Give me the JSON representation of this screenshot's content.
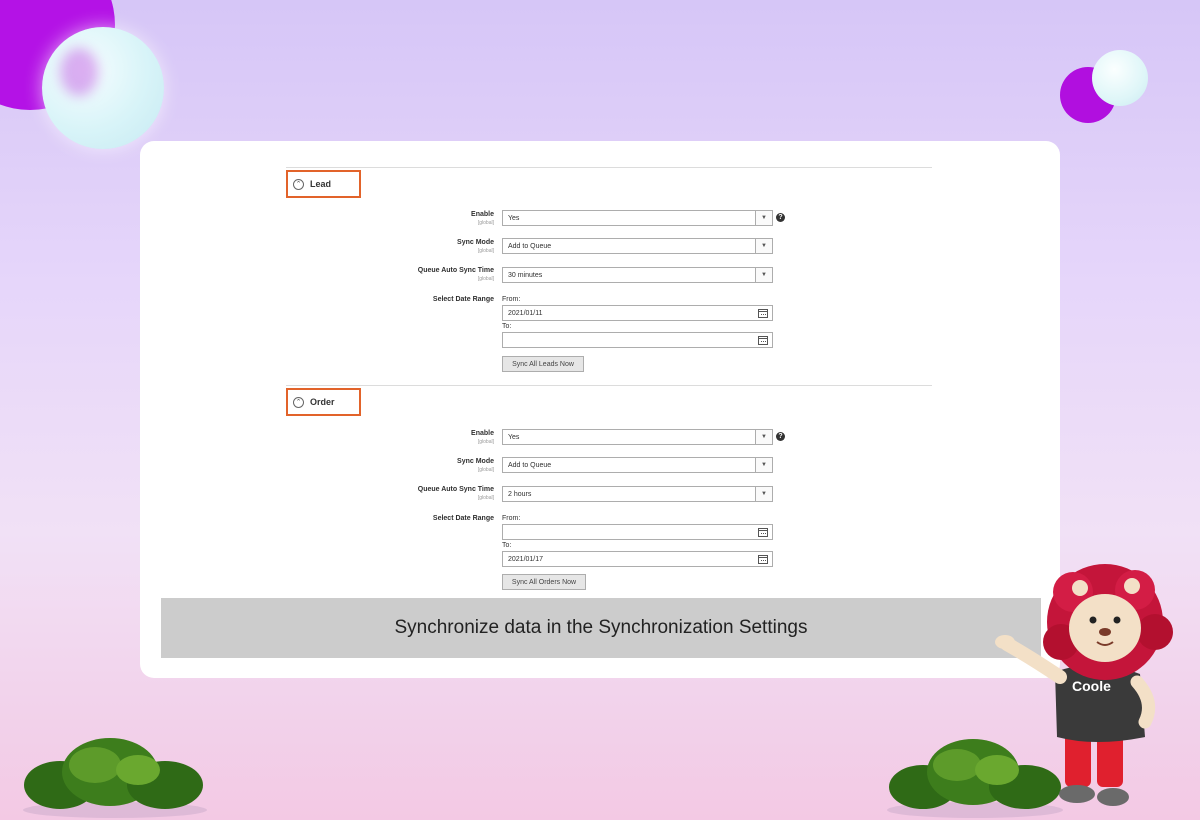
{
  "lead": {
    "title": "Lead",
    "enable_label": "Enable",
    "enable_scope": "[global]",
    "enable_value": "Yes",
    "sync_mode_label": "Sync Mode",
    "sync_mode_scope": "[global]",
    "sync_mode_value": "Add to Queue",
    "auto_sync_label": "Queue Auto Sync Time",
    "auto_sync_scope": "[global]",
    "auto_sync_value": "30 minutes",
    "date_range_label": "Select Date Range",
    "from_label": "From:",
    "from_value": "2021/01/11",
    "to_label": "To:",
    "to_value": "",
    "sync_button": "Sync All Leads Now"
  },
  "order": {
    "title": "Order",
    "enable_label": "Enable",
    "enable_scope": "[global]",
    "enable_value": "Yes",
    "sync_mode_label": "Sync Mode",
    "sync_mode_scope": "[global]",
    "sync_mode_value": "Add to Queue",
    "auto_sync_label": "Queue Auto Sync Time",
    "auto_sync_scope": "[global]",
    "auto_sync_value": "2 hours",
    "date_range_label": "Select Date Range",
    "from_label": "From:",
    "from_value": "",
    "to_label": "To:",
    "to_value": "2021/01/17",
    "sync_button": "Sync All Orders Now"
  },
  "help_glyph": "?",
  "caption": "Synchronize data in the Synchronization Settings",
  "mascot_shirt_text": "Coole",
  "colors": {
    "highlight_border": "#e2632a",
    "caption_bar": "#cccccc",
    "accent_purple": "#b412e6"
  },
  "icons": [
    "collapse-chevron-icon",
    "help-icon",
    "dropdown-arrow-icon",
    "calendar-icon"
  ]
}
